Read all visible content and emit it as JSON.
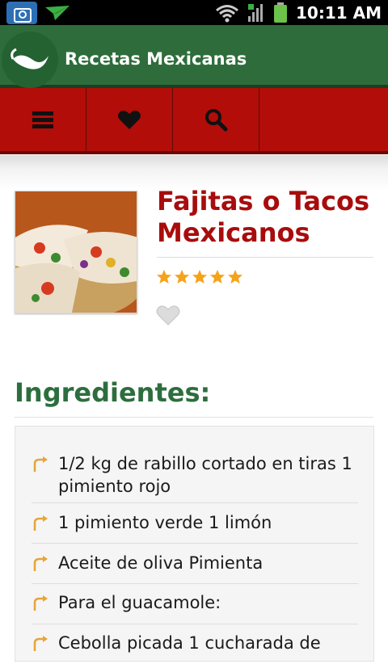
{
  "status_bar": {
    "time": "10:11 AM"
  },
  "app": {
    "title": "Recetas Mexicanas"
  },
  "toolbar": {
    "icons": [
      "menu-icon",
      "heart-icon",
      "search-icon"
    ]
  },
  "recipe": {
    "title": "Fajitas o Tacos Mexicanos",
    "rating": 5,
    "rating_max": 5,
    "favorite": false
  },
  "ingredients": {
    "heading": "Ingredientes:",
    "items": [
      "1/2 kg de rabillo cortado en tiras 1 pimiento rojo",
      "1 pimiento verde 1 limón",
      "Aceite de oliva Pimienta",
      "Para el guacamole:",
      "Cebolla picada 1 cucharada de"
    ]
  },
  "colors": {
    "green": "#2e6d3b",
    "red": "#b20d08",
    "title_red": "#a80c0c",
    "heading_green": "#2d6e3e",
    "star": "#f6a21a"
  }
}
